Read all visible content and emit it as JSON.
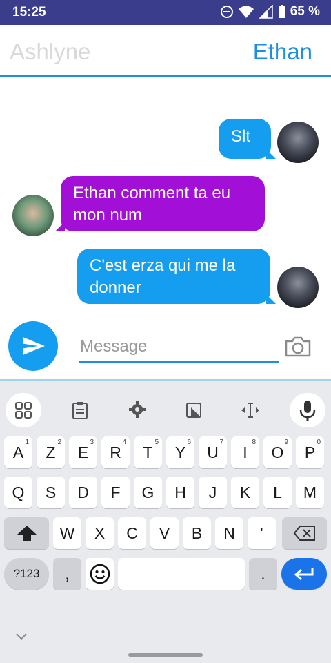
{
  "status_bar": {
    "time": "15:25",
    "battery_pct": "65 %"
  },
  "header": {
    "left_name": "Ashlyne",
    "right_name": "Ethan"
  },
  "messages": [
    {
      "from": "Ethan",
      "text": "Slt"
    },
    {
      "from": "Ashlyne",
      "text": "Ethan comment ta eu mon num"
    },
    {
      "from": "Ethan",
      "text": "C'est erza qui me la donner"
    }
  ],
  "composer": {
    "placeholder": "Message"
  },
  "keyboard": {
    "row1": [
      {
        "label": "A",
        "hint": "1"
      },
      {
        "label": "Z",
        "hint": "2"
      },
      {
        "label": "E",
        "hint": "3"
      },
      {
        "label": "R",
        "hint": "4"
      },
      {
        "label": "T",
        "hint": "5"
      },
      {
        "label": "Y",
        "hint": "6"
      },
      {
        "label": "U",
        "hint": "7"
      },
      {
        "label": "I",
        "hint": "8"
      },
      {
        "label": "O",
        "hint": "9"
      },
      {
        "label": "P",
        "hint": "0"
      }
    ],
    "row2": [
      "Q",
      "S",
      "D",
      "F",
      "G",
      "H",
      "J",
      "K",
      "L",
      "M"
    ],
    "row3": [
      "W",
      "X",
      "C",
      "V",
      "B",
      "N",
      "'"
    ],
    "row4": {
      "symbols": "?123",
      "comma": ",",
      "period": "."
    }
  },
  "colors": {
    "accent": "#1e8ee0",
    "sent_bubble": "#159df0",
    "received_bubble": "#a20fd6",
    "status_bar": "#3a3d8c"
  }
}
